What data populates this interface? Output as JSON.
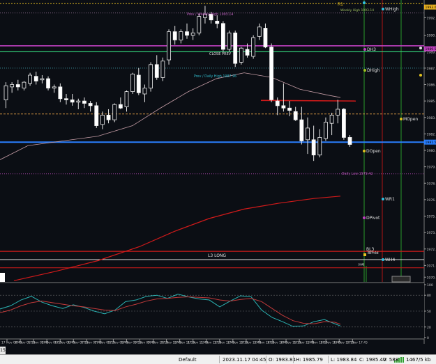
{
  "chart": {
    "y_ticks": [
      "1993.0",
      "1992.1",
      "1990.6",
      "1989.2",
      "1987.8",
      "1986.4",
      "1985.0",
      "1983.6",
      "1982.2",
      "1980.8",
      "1979.4",
      "1978.0",
      "1976.6",
      "1975.2",
      "1973.8",
      "1972.4",
      "1971.0",
      "1970.0"
    ],
    "osc_ticks": [
      "100",
      "80",
      "50",
      "20",
      "0"
    ],
    "x_labels": [
      "17 Nov 04:45",
      "17 Nov 05:15",
      "17 Nov 05:45",
      "17 Nov 06:15",
      "17 Nov 06:45",
      "17 Nov 07:15",
      "17 Nov 07:45",
      "17 Nov 08:15",
      "17 Nov 08:45",
      "17 Nov 09:15",
      "17 Nov 09:45",
      "17 Nov 10:15",
      "17 Nov 10:45",
      "17 Nov 11:15",
      "17 Nov 11:45",
      "17 Nov 12:15",
      "17 Nov 12:45",
      "17 Nov 13:15",
      "17 Nov 13:45",
      "17 Nov 14:15",
      "17 Nov 14:45",
      "17 Nov 15:15",
      "17 Nov 15:45",
      "17 Nov 16:15",
      "17 Nov 16:45",
      "17 Nov 17:15",
      "17 Nov 17:45"
    ],
    "price_tags": [
      {
        "text": "1993.0",
        "price": 1993.0,
        "color": "#e8b020"
      },
      {
        "text": "1989.5",
        "price": 1989.45,
        "color": "#c040c0"
      },
      {
        "text": "1981.5",
        "price": 1981.5,
        "color": "#2a7fff"
      }
    ],
    "level_labels": {
      "r1": "R1",
      "wp_high": "Weekly High 1993.14",
      "prev_weekly_high": "Prev / Weekly High 1993.14",
      "close_prev": "CLOSE PREV",
      "prev_daily_high": "Prev / Daily High 1987.96",
      "daily_low": "Daily Low 1979.42",
      "l3_long": "L3 LONG",
      "wr1": "WR1",
      "wh4": "WH4",
      "h4": "H4",
      "wp": "WPivot",
      "whigh": "WHigh",
      "dh3": "DH3",
      "dhigh": "DHigh",
      "mopen": "MOpen",
      "dopen": "DOpen",
      "dpivot": "DPivot",
      "bl3": "BL3",
      "bphld": "BPhld"
    },
    "left_tab": "15",
    "colors": {
      "background": "#0b0e14",
      "bull_candle": "#ffffff",
      "bear_candle": "#ffffff",
      "blue_line": "#2a7fff",
      "magenta_line": "#c040c0",
      "green_line": "#33d17a",
      "red_line": "#d11a1a",
      "ma_pink": "#c79ea7",
      "osc_cyan": "#2bb3b3",
      "osc_red": "#c23a3a"
    }
  },
  "status": {
    "profile": "Default",
    "datetime": "2023.11.17 04:45",
    "open": "O: 1983.84",
    "high": "H: 1985.79",
    "low": "L: 1983.84",
    "close": "C: 1985.40",
    "volume": "V: 588",
    "traffic": "1467/5 kb"
  }
}
